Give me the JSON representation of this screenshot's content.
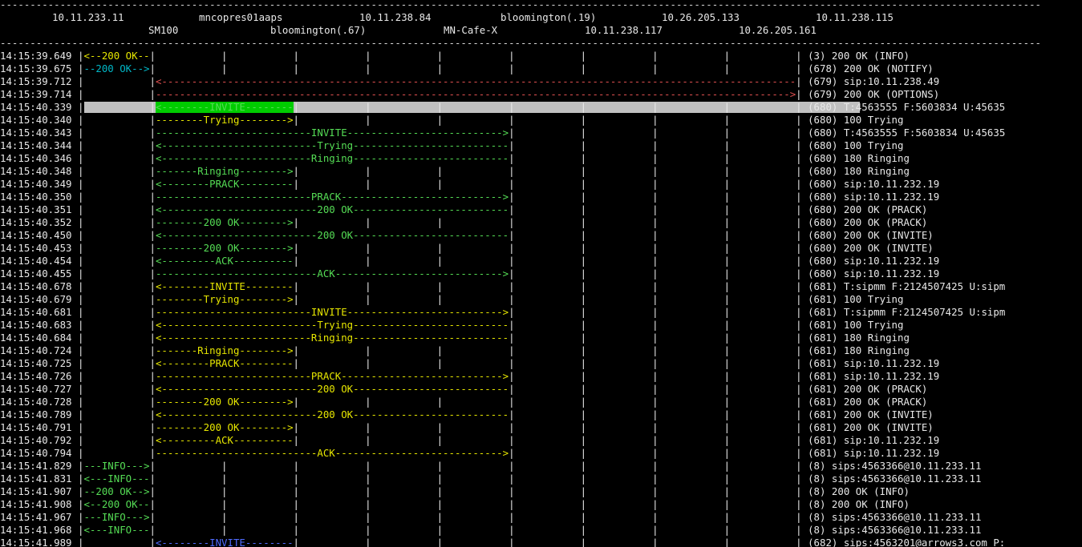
{
  "hosts_row1": [
    "10.11.233.11",
    "mncopres01aaps",
    "10.11.238.84",
    "bloomington(.19)",
    "10.26.205.133",
    "10.11.238.115"
  ],
  "hosts_row2": [
    "SM100",
    "bloomington(.67)",
    "MN-Cafe-X",
    "10.11.238.117",
    "10.26.205.161"
  ],
  "rows": [
    {
      "time": "14:15:39.649",
      "a": 0,
      "b": 1,
      "label": "200 OK",
      "dir": "left",
      "color": "yellow",
      "info": "(3) 200 OK (INFO)"
    },
    {
      "time": "14:15:39.675",
      "a": 0,
      "b": 1,
      "label": "200 OK",
      "dir": "right",
      "color": "cyan",
      "info": "(678) 200 OK (NOTIFY)"
    },
    {
      "time": "14:15:39.712",
      "a": 1,
      "b": 10,
      "label": "",
      "dir": "left",
      "color": "red",
      "info": "(679) sip:10.11.238.49"
    },
    {
      "time": "14:15:39.714",
      "a": 1,
      "b": 10,
      "label": "",
      "dir": "right",
      "color": "red",
      "info": "(679) 200 OK (OPTIONS)"
    },
    {
      "time": "14:15:40.339",
      "a": 1,
      "b": 3,
      "label": "INVITE",
      "dir": "left",
      "color": "green",
      "info": "(680) T:4563555 F:5603834 U:45635",
      "highlight": true
    },
    {
      "time": "14:15:40.340",
      "a": 1,
      "b": 3,
      "label": "Trying",
      "dir": "right",
      "color": "yellow",
      "info": "(680) 100 Trying"
    },
    {
      "time": "14:15:40.343",
      "a": 1,
      "b": 6,
      "label": "INVITE",
      "dir": "right",
      "color": "green",
      "info": "(680) T:4563555 F:5603834 U:45635"
    },
    {
      "time": "14:15:40.344",
      "a": 1,
      "b": 6,
      "label": "Trying",
      "dir": "left",
      "color": "green",
      "info": "(680) 100 Trying"
    },
    {
      "time": "14:15:40.346",
      "a": 1,
      "b": 6,
      "label": "Ringing",
      "dir": "left",
      "color": "green",
      "info": "(680) 180 Ringing"
    },
    {
      "time": "14:15:40.348",
      "a": 1,
      "b": 3,
      "label": "Ringing",
      "dir": "right",
      "color": "green",
      "info": "(680) 180 Ringing"
    },
    {
      "time": "14:15:40.349",
      "a": 1,
      "b": 3,
      "label": "PRACK",
      "dir": "left",
      "color": "green",
      "info": "(680) sip:10.11.232.19"
    },
    {
      "time": "14:15:40.350",
      "a": 1,
      "b": 6,
      "label": "PRACK",
      "dir": "right",
      "color": "green",
      "info": "(680) sip:10.11.232.19"
    },
    {
      "time": "14:15:40.351",
      "a": 1,
      "b": 6,
      "label": "200 OK",
      "dir": "left",
      "color": "green",
      "info": "(680) 200 OK (PRACK)"
    },
    {
      "time": "14:15:40.352",
      "a": 1,
      "b": 3,
      "label": "200 OK",
      "dir": "right",
      "color": "green",
      "info": "(680) 200 OK (PRACK)"
    },
    {
      "time": "14:15:40.450",
      "a": 1,
      "b": 6,
      "label": "200 OK",
      "dir": "left",
      "color": "green",
      "info": "(680) 200 OK (INVITE)"
    },
    {
      "time": "14:15:40.453",
      "a": 1,
      "b": 3,
      "label": "200 OK",
      "dir": "right",
      "color": "green",
      "info": "(680) 200 OK (INVITE)"
    },
    {
      "time": "14:15:40.454",
      "a": 1,
      "b": 3,
      "label": "ACK",
      "dir": "left",
      "color": "green",
      "info": "(680) sip:10.11.232.19"
    },
    {
      "time": "14:15:40.455",
      "a": 1,
      "b": 6,
      "label": "ACK",
      "dir": "right",
      "color": "green",
      "info": "(680) sip:10.11.232.19"
    },
    {
      "time": "14:15:40.678",
      "a": 1,
      "b": 3,
      "label": "INVITE",
      "dir": "left",
      "color": "yellow",
      "info": "(681) T:sipmm F:2124507425 U:sipm"
    },
    {
      "time": "14:15:40.679",
      "a": 1,
      "b": 3,
      "label": "Trying",
      "dir": "right",
      "color": "yellow",
      "info": "(681) 100 Trying"
    },
    {
      "time": "14:15:40.681",
      "a": 1,
      "b": 6,
      "label": "INVITE",
      "dir": "right",
      "color": "yellow",
      "info": "(681) T:sipmm F:2124507425 U:sipm"
    },
    {
      "time": "14:15:40.683",
      "a": 1,
      "b": 6,
      "label": "Trying",
      "dir": "left",
      "color": "yellow",
      "info": "(681) 100 Trying"
    },
    {
      "time": "14:15:40.684",
      "a": 1,
      "b": 6,
      "label": "Ringing",
      "dir": "left",
      "color": "yellow",
      "info": "(681) 180 Ringing"
    },
    {
      "time": "14:15:40.724",
      "a": 1,
      "b": 3,
      "label": "Ringing",
      "dir": "right",
      "color": "yellow",
      "info": "(681) 180 Ringing"
    },
    {
      "time": "14:15:40.725",
      "a": 1,
      "b": 3,
      "label": "PRACK",
      "dir": "left",
      "color": "yellow",
      "info": "(681) sip:10.11.232.19"
    },
    {
      "time": "14:15:40.726",
      "a": 1,
      "b": 6,
      "label": "PRACK",
      "dir": "right",
      "color": "yellow",
      "info": "(681) sip:10.11.232.19"
    },
    {
      "time": "14:15:40.727",
      "a": 1,
      "b": 6,
      "label": "200 OK",
      "dir": "left",
      "color": "yellow",
      "info": "(681) 200 OK (PRACK)"
    },
    {
      "time": "14:15:40.728",
      "a": 1,
      "b": 3,
      "label": "200 OK",
      "dir": "right",
      "color": "yellow",
      "info": "(681) 200 OK (PRACK)"
    },
    {
      "time": "14:15:40.789",
      "a": 1,
      "b": 6,
      "label": "200 OK",
      "dir": "left",
      "color": "yellow",
      "info": "(681) 200 OK (INVITE)"
    },
    {
      "time": "14:15:40.791",
      "a": 1,
      "b": 3,
      "label": "200 OK",
      "dir": "right",
      "color": "yellow",
      "info": "(681) 200 OK (INVITE)"
    },
    {
      "time": "14:15:40.792",
      "a": 1,
      "b": 3,
      "label": "ACK",
      "dir": "left",
      "color": "yellow",
      "info": "(681) sip:10.11.232.19"
    },
    {
      "time": "14:15:40.794",
      "a": 1,
      "b": 6,
      "label": "ACK",
      "dir": "right",
      "color": "yellow",
      "info": "(681) sip:10.11.232.19"
    },
    {
      "time": "14:15:41.829",
      "a": 0,
      "b": 1,
      "label": "INFO",
      "dir": "right",
      "color": "green",
      "info": "(8) sips:4563366@10.11.233.11"
    },
    {
      "time": "14:15:41.831",
      "a": 0,
      "b": 1,
      "label": "INFO",
      "dir": "left",
      "color": "green",
      "info": "(8) sips:4563366@10.11.233.11"
    },
    {
      "time": "14:15:41.907",
      "a": 0,
      "b": 1,
      "label": "200 OK",
      "dir": "right",
      "color": "green",
      "info": "(8) 200 OK (INFO)"
    },
    {
      "time": "14:15:41.908",
      "a": 0,
      "b": 1,
      "label": "200 OK",
      "dir": "left",
      "color": "green",
      "info": "(8) 200 OK (INFO)"
    },
    {
      "time": "14:15:41.967",
      "a": 0,
      "b": 1,
      "label": "INFO",
      "dir": "right",
      "color": "green",
      "info": "(8) sips:4563366@10.11.233.11"
    },
    {
      "time": "14:15:41.968",
      "a": 0,
      "b": 1,
      "label": "INFO",
      "dir": "left",
      "color": "green",
      "info": "(8) sips:4563366@10.11.233.11"
    },
    {
      "time": "14:15:41.989",
      "a": 1,
      "b": 3,
      "label": "INVITE",
      "dir": "left",
      "color": "blue",
      "info": "(682) sips:4563201@arrows3.com P:"
    }
  ]
}
